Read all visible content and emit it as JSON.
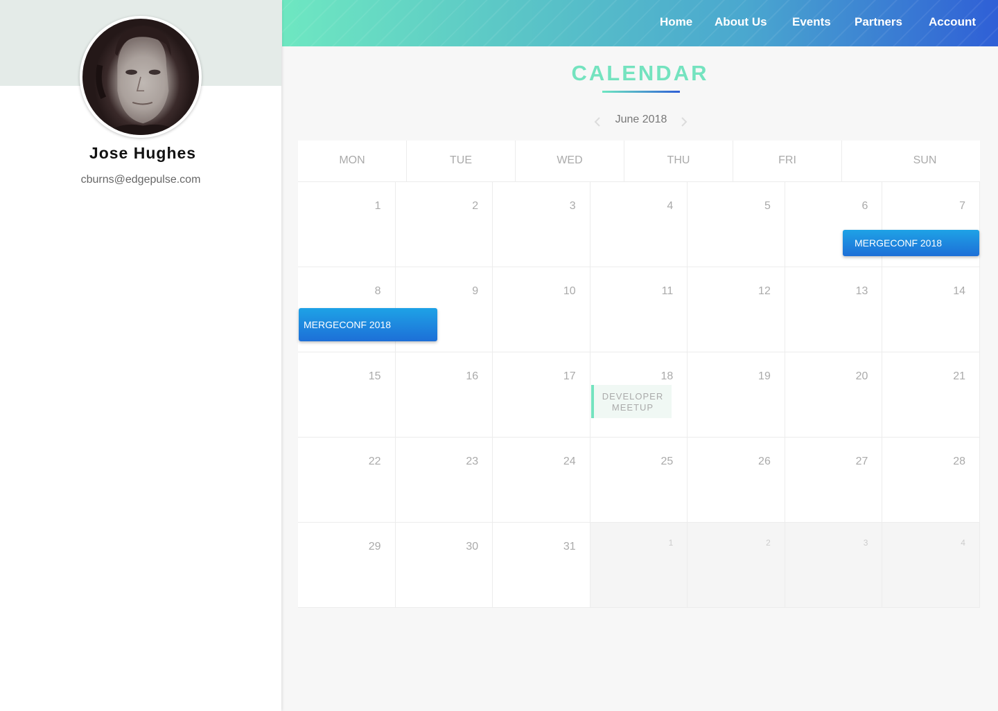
{
  "profile": {
    "name": "Jose Hughes",
    "email": "cburns@edgepulse.com"
  },
  "nav": {
    "items": [
      "Home",
      "About Us",
      "Events",
      "Partners",
      "Account"
    ]
  },
  "page": {
    "title": "CALENDAR",
    "month_label": "June 2018"
  },
  "calendar": {
    "weekdays": [
      "MON",
      "TUE",
      "WED",
      "THU",
      "FRI",
      "SUN"
    ],
    "weeks": [
      [
        "1",
        "2",
        "3",
        "4",
        "5",
        "6",
        "7"
      ],
      [
        "8",
        "9",
        "10",
        "11",
        "12",
        "13",
        "14"
      ],
      [
        "15",
        "16",
        "17",
        "18",
        "19",
        "20",
        "21"
      ],
      [
        "22",
        "23",
        "24",
        "25",
        "26",
        "27",
        "28"
      ],
      [
        "29",
        "30",
        "31",
        "1",
        "2",
        "3",
        "4"
      ]
    ],
    "events": {
      "mergeconf_1": "MERGECONF 2018",
      "mergeconf_2": "MERGECONF 2018",
      "meetup": "DEVELOPER MEETUP"
    }
  },
  "colors": {
    "accent_green": "#74e3bf",
    "accent_blue": "#2f5fd6",
    "event_blue": "#1d6fd7"
  },
  "icons": {
    "prev": "chevron-left-icon",
    "next": "chevron-right-icon"
  }
}
